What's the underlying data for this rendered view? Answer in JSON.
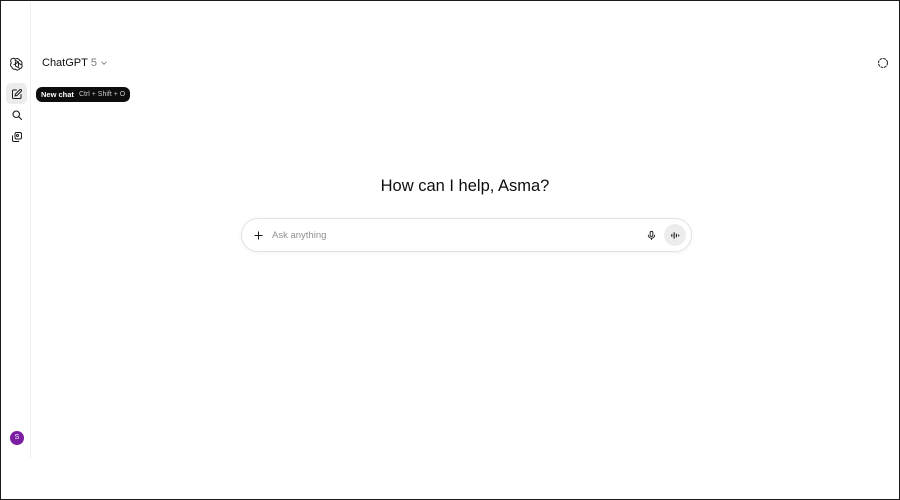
{
  "header": {
    "model_name": "ChatGPT",
    "model_version": "5"
  },
  "sidebar": {
    "items": [
      {
        "name": "logo",
        "icon": "openai-logo-icon"
      },
      {
        "name": "new-chat",
        "icon": "compose-icon"
      },
      {
        "name": "search",
        "icon": "search-icon"
      },
      {
        "name": "library",
        "icon": "library-icon"
      }
    ],
    "avatar_initial": "S",
    "avatar_color": "#7b1fa2"
  },
  "tooltip": {
    "title": "New chat",
    "shortcut": "Ctrl + Shift + O"
  },
  "main": {
    "greeting": "How can I help, Asma?"
  },
  "composer": {
    "placeholder": "Ask anything",
    "value": "",
    "icons": [
      "plus-icon",
      "microphone-icon",
      "voice-mode-icon"
    ]
  },
  "colors": {
    "tooltip_bg": "#0d0d0d",
    "voice_button_bg": "#ececec",
    "border": "#e3e3e3"
  }
}
